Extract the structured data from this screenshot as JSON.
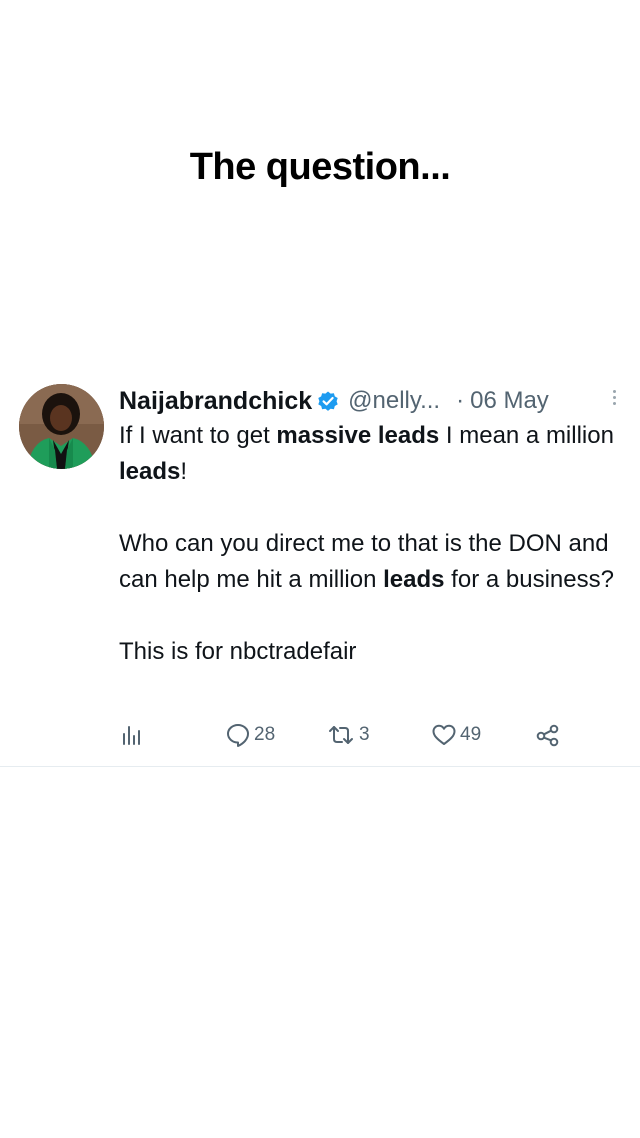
{
  "headline": "The question...",
  "tweet": {
    "author": {
      "name": "Naijabrandchick",
      "handle": "@nelly...",
      "separator": "·",
      "date": "06 May"
    },
    "paragraphs": [
      [
        {
          "text": "If I want to get ",
          "bold": false
        },
        {
          "text": "massive leads",
          "bold": true
        },
        {
          "text": " I mean a million ",
          "bold": false
        },
        {
          "text": "leads",
          "bold": true
        },
        {
          "text": "!",
          "bold": false
        }
      ],
      [
        {
          "text": "Who can you direct me to that is the DON and can help me hit a million ",
          "bold": false
        },
        {
          "text": "leads",
          "bold": true
        },
        {
          "text": " for a business?",
          "bold": false
        }
      ],
      [
        {
          "text": "This is for nbctradefair",
          "bold": false
        }
      ]
    ],
    "actions": {
      "analytics": {
        "icon": "analytics-icon"
      },
      "replies": {
        "icon": "reply-icon",
        "count": "28"
      },
      "retweets": {
        "icon": "retweet-icon",
        "count": "3"
      },
      "likes": {
        "icon": "heart-icon",
        "count": "49"
      },
      "share": {
        "icon": "share-icon"
      }
    }
  },
  "colors": {
    "verified": "#1d9bf0",
    "secondary_text": "#536471",
    "avatar_jacket": "#1f9d5a"
  }
}
